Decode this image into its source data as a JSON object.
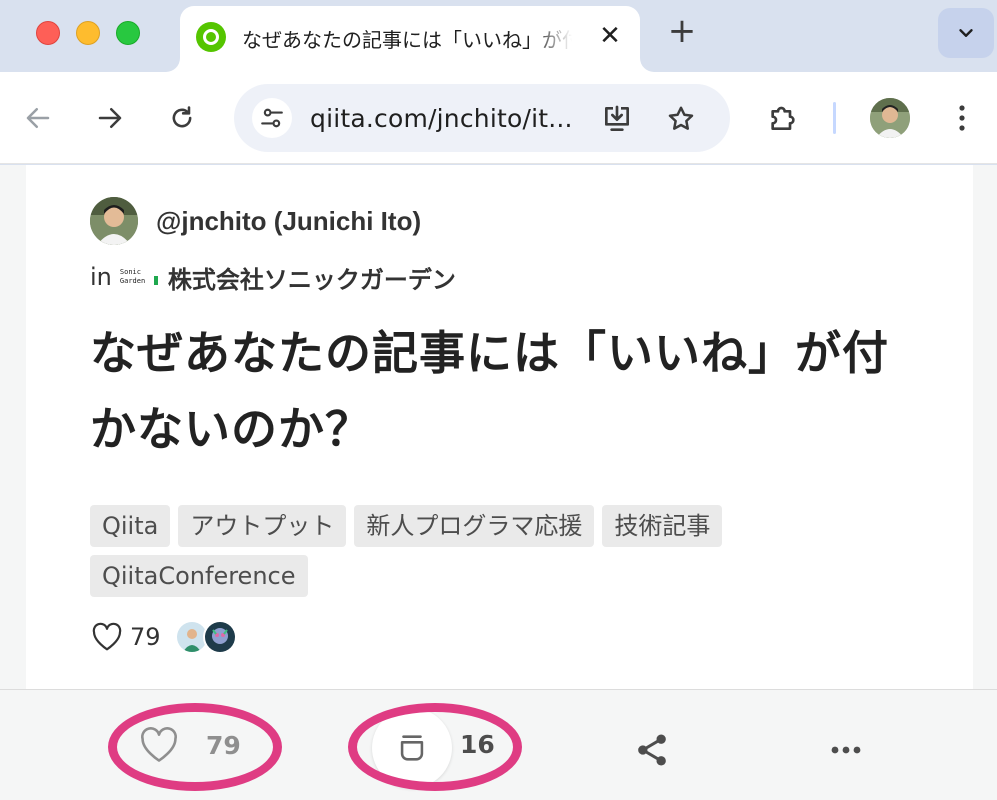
{
  "browser": {
    "tab_title": "なぜあなたの記事には「いいね」が付かないのか？ | Qiita",
    "tab_close": "✕",
    "new_tab": "+",
    "url": "qiita.com/jnchito/it..."
  },
  "article": {
    "author": "@jnchito (Junichi Ito)",
    "org_prefix": "in",
    "org_logo_line1": "Sonic",
    "org_logo_line2": "Garden",
    "org_name": "株式会社ソニックガーデン",
    "title": "なぜあなたの記事には「いいね」が付かないのか？",
    "tags": [
      "Qiita",
      "アウトプット",
      "新人プログラマ応援",
      "技術記事",
      "QiitaConference"
    ],
    "likes": "79"
  },
  "bottom_bar": {
    "like_count": "79",
    "stock_count": "16"
  },
  "colors": {
    "qiita_green": "#55c500",
    "highlight": "#df3c83",
    "tabstrip": "#d9e1ef"
  }
}
